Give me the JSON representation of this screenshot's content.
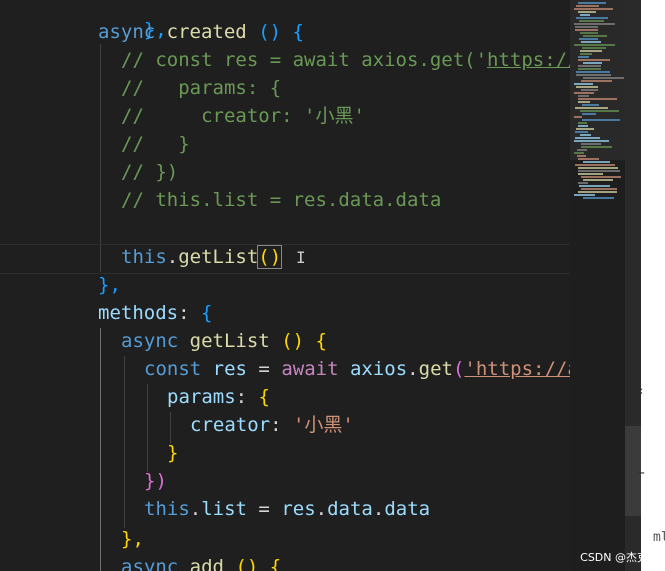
{
  "code": {
    "l1_close": "},",
    "l2_async": "async",
    "l2_name": "created",
    "l2_parens": "()",
    "l2_brace": "{",
    "l3": "// const res = await axios.get('",
    "l3_url": "https://",
    "l4": "//   params: {",
    "l5": "//     creator: '小黑'",
    "l6": "//   }",
    "l7": "// })",
    "l8": "// this.list = res.data.data",
    "l10_this": "this",
    "l10_fn": "getList",
    "l10_parens": "()",
    "l11": "},",
    "l12_methods": "methods",
    "l12_brace": "{",
    "l13_async": "async",
    "l13_name": "getList",
    "l13_parens": "()",
    "l13_brace": "{",
    "l14_const": "const",
    "l14_res": "res",
    "l14_await": "await",
    "l14_axios": "axios",
    "l14_get": "get",
    "l14_url": "'https://a",
    "l15_params": "params",
    "l15_brace": "{",
    "l16_creator": "creator",
    "l16_val": "'小黑'",
    "l17": "}",
    "l18": "})",
    "l19_this": "this",
    "l19_list": "list",
    "l19_res": "res",
    "l19_data1": "data",
    "l19_data2": "data",
    "l20": "},",
    "l21_async": "async",
    "l21_name": "add",
    "l21_rest": "() {"
  },
  "right_panel": {
    "partial_label": "ml",
    "watermark": "CSDN @杰克尼"
  }
}
